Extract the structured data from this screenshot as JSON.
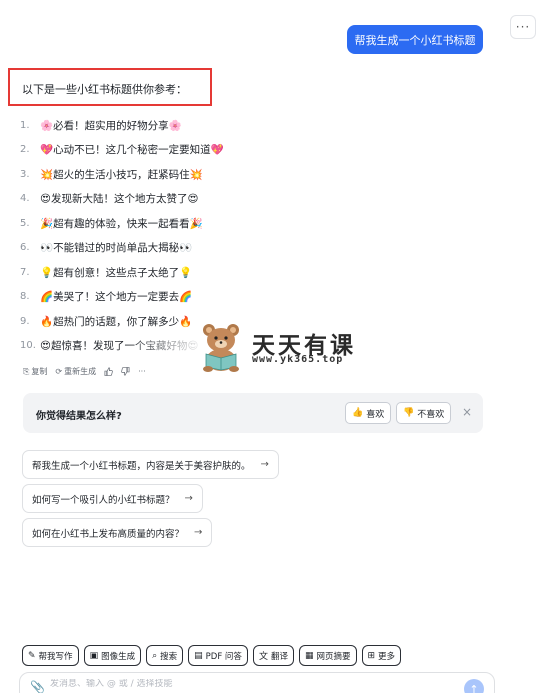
{
  "header": {
    "more_label": "···"
  },
  "user_message": "帮我生成一个小红书标题",
  "reply": {
    "intro": "以下是一些小红书标题供你参考：",
    "titles": [
      {
        "num": "1.",
        "text": "🌸必看！超实用的好物分享🌸"
      },
      {
        "num": "2.",
        "text": "💖心动不已！这几个秘密一定要知道💖"
      },
      {
        "num": "3.",
        "text": "💥超火的生活小技巧，赶紧码住💥"
      },
      {
        "num": "4.",
        "text": "😍发现新大陆！这个地方太赞了😍"
      },
      {
        "num": "5.",
        "text": "🎉超有趣的体验，快来一起看看🎉"
      },
      {
        "num": "6.",
        "text": "👀不能错过的时尚单品大揭秘👀"
      },
      {
        "num": "7.",
        "text": "💡超有创意！这些点子太绝了💡"
      },
      {
        "num": "8.",
        "text": "🌈美哭了！这个地方一定要去🌈"
      },
      {
        "num": "9.",
        "text": "🔥超热门的话题，你了解多少🔥"
      },
      {
        "num": "10.",
        "text": "😍超惊喜！发现了一个宝藏好物😍"
      }
    ]
  },
  "watermark": {
    "title": "天天有课",
    "url": "www.yk365.top"
  },
  "actions": {
    "copy": "复制",
    "regenerate": "重新生成",
    "like_icon": "thumbs-up",
    "dislike_icon": "thumbs-down",
    "more": "···"
  },
  "feedback": {
    "question": "你觉得结果怎么样?",
    "like": "喜欢",
    "dislike": "不喜欢",
    "close": "×"
  },
  "suggestions": [
    "帮我生成一个小红书标题，内容是关于美容护肤的。",
    "如何写一个吸引人的小红书标题？",
    "如何在小红书上发布高质量的内容？"
  ],
  "toolbar": {
    "items": [
      {
        "icon": "✎",
        "label": "帮我写作"
      },
      {
        "icon": "▣",
        "label": "图像生成"
      },
      {
        "icon": "⌕",
        "label": "搜索"
      },
      {
        "icon": "▤",
        "label": "PDF 问答"
      },
      {
        "icon": "文",
        "label": "翻译"
      },
      {
        "icon": "▦",
        "label": "网页摘要"
      },
      {
        "icon": "⊞",
        "label": "更多"
      }
    ]
  },
  "input": {
    "placeholder": "发消息、输入 @ 或 / 选择技能"
  },
  "colors": {
    "accent": "#2c6bf2",
    "highlight_box": "#e53935"
  }
}
